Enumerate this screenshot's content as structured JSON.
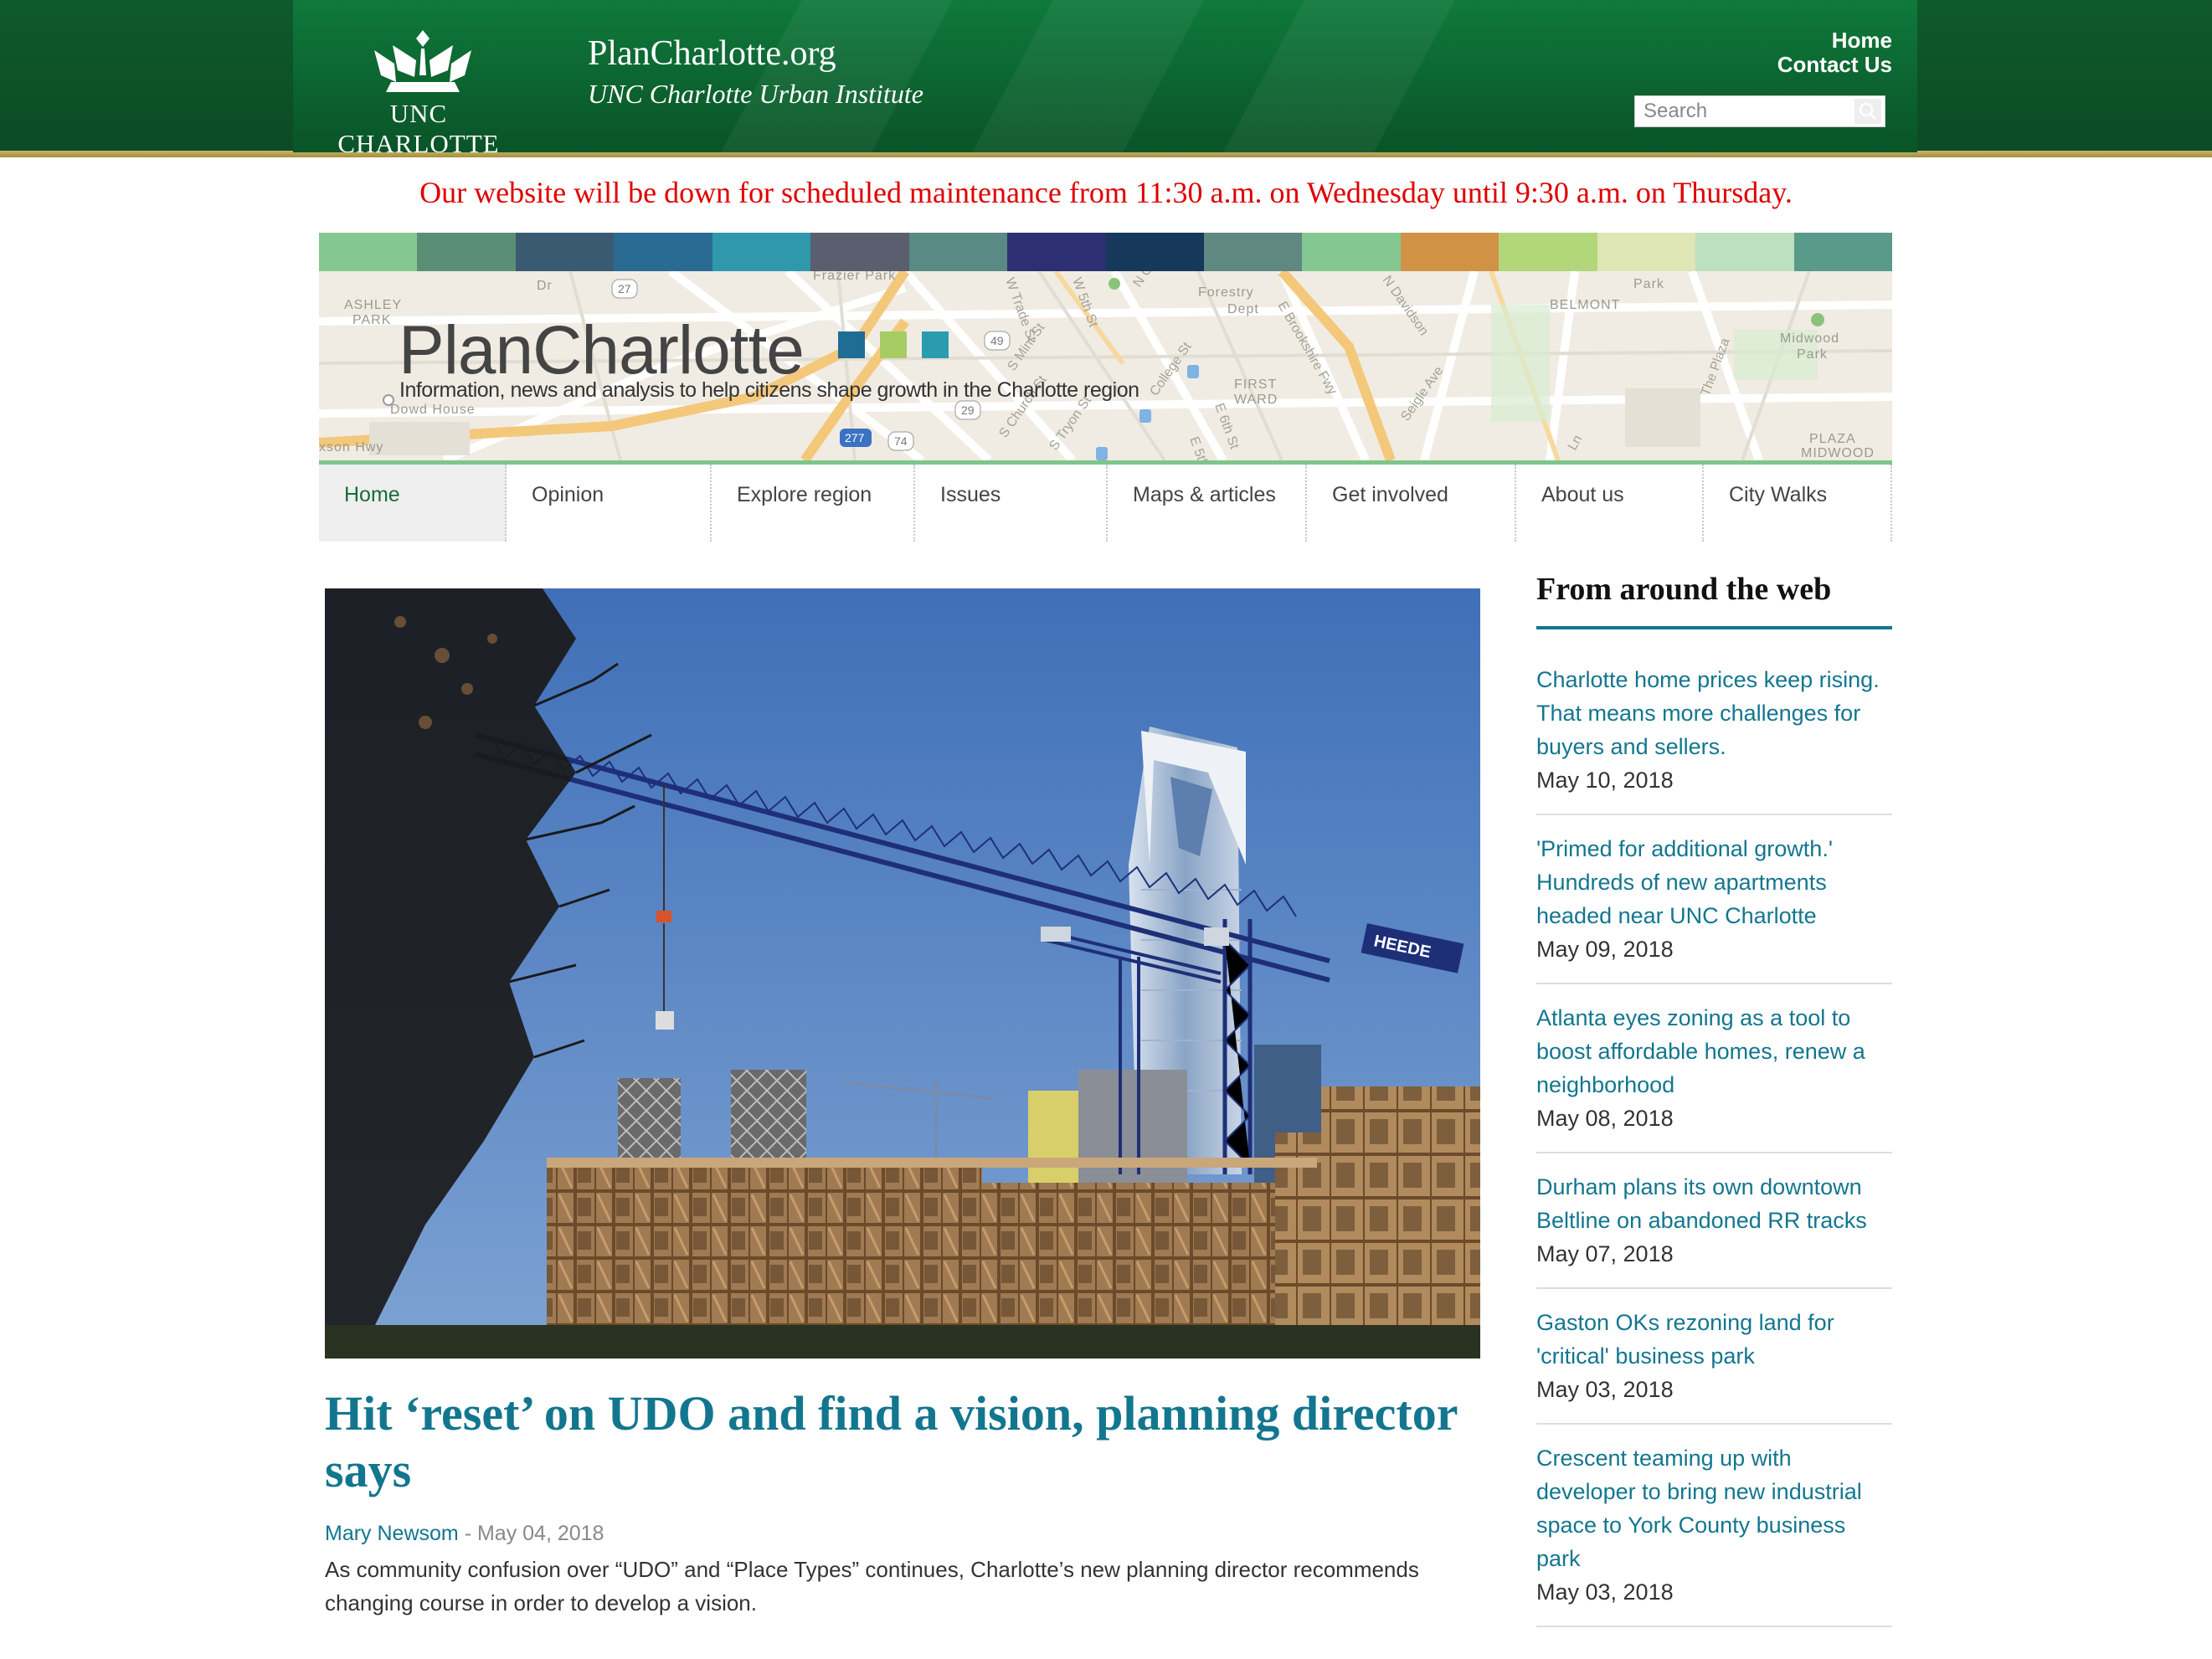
{
  "header": {
    "university_name": "UNC CHARLOTTE",
    "site_title": "PlanCharlotte.org",
    "site_subtitle": "UNC Charlotte Urban Institute",
    "top_links": [
      "Home",
      "Contact Us"
    ],
    "search_placeholder": "Search"
  },
  "maintenance_notice": "Our website will be down for scheduled maintenance from 11:30 a.m. on Wednesday until 9:30 a.m. on Thursday.",
  "color_bar": [
    "#84c891",
    "#5a8f76",
    "#3a5a72",
    "#2a6b94",
    "#2f98ab",
    "#5a5f70",
    "#5a8a84",
    "#2d2f73",
    "#16385a",
    "#5e8880",
    "#84c891",
    "#d29246",
    "#b2d67a",
    "#dde6b4",
    "#bde0c0",
    "#5a9a8a"
  ],
  "banner": {
    "brand_name": "PlanCharlotte",
    "brand_square_colors": [
      "#1f6c94",
      "#a6cc63",
      "#2a9cb0"
    ],
    "tagline": "Information, news and analysis to help citizens shape growth in the Charlotte region",
    "map_labels": [
      "ASHLEY",
      "PARK",
      "Frazier Park",
      "Forestry",
      "Dept",
      "BELMONT",
      "Park",
      "Midwood",
      "Park",
      "Dowd House",
      "xson Hwy",
      "FIRST",
      "WARD",
      "PLAZA",
      "MIDWOOD",
      "E Brookshire Fwy",
      "N Davidson",
      "Seigle Ave",
      "The Plaza",
      "W Trade St",
      "W 5th St",
      "N Church",
      "College St",
      "S Church St",
      "S Tryon St",
      "S Mint St",
      "E 6th St",
      "E 5th St",
      "Ln",
      "27",
      "49",
      "29",
      "74",
      "277",
      "Dr"
    ]
  },
  "nav": {
    "items": [
      "Home",
      "Opinion",
      "Explore region",
      "Issues",
      "Maps & articles",
      "Get involved",
      "About us",
      "City Walks"
    ],
    "active": "Home"
  },
  "hero": {
    "crane_sign": "HEEDE"
  },
  "article": {
    "headline": "Hit ‘reset’ on UDO and find a vision, planning director says",
    "author": "Mary Newsom",
    "date_separator": " - ",
    "date": "May 04, 2018",
    "summary": "As community confusion over “UDO” and “Place Types” continues, Charlotte’s new planning director recommends changing course in order to develop a vision."
  },
  "sidebar": {
    "title": "From around the web",
    "items": [
      {
        "title": "Charlotte home prices keep rising. That means more challenges for buyers and sellers.",
        "date": "May 10, 2018"
      },
      {
        "title": "'Primed for additional growth.' Hundreds of new apartments headed near UNC Charlotte",
        "date": "May 09, 2018"
      },
      {
        "title": "Atlanta eyes zoning as a tool to boost affordable homes, renew a neighborhood",
        "date": "May 08, 2018"
      },
      {
        "title": "Durham plans its own downtown Beltline on abandoned RR tracks",
        "date": "May 07, 2018"
      },
      {
        "title": "Gaston OKs rezoning land for 'critical' business park",
        "date": "May 03, 2018"
      },
      {
        "title": "Crescent teaming up with developer to bring new industrial space to York County business park",
        "date": "May 03, 2018"
      }
    ]
  }
}
